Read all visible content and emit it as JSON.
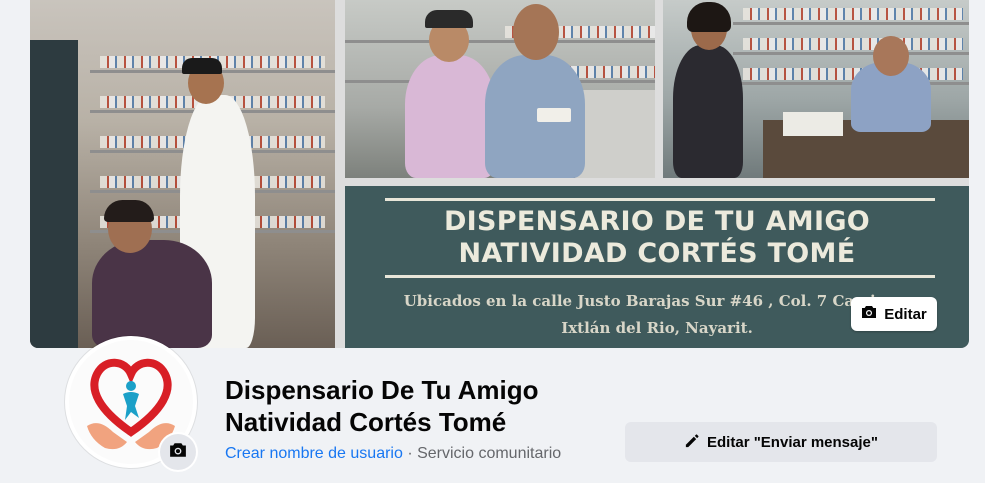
{
  "cover": {
    "banner_line1": "DISPENSARIO DE TU AMIGO",
    "banner_line2": "NATIVIDAD CORTÉS TOMÉ",
    "banner_address1": "Ubicados en la calle Justo Barajas  Sur #46 , Col. 7 Caminos.",
    "banner_address2": "Ixtlán del Rio, Nayarit.",
    "edit_label": "Editar",
    "edit_icon": "camera-icon"
  },
  "profile": {
    "name_line1": "Dispensario De Tu Amigo",
    "name_line2": "Natividad Cortés Tomé",
    "username_link": "Crear nombre de usuario",
    "separator": " · ",
    "category": "Servicio comunitario",
    "avatar_icon": "camera-icon"
  },
  "actions": {
    "send_message_label": "Editar \"Enviar mensaje\"",
    "send_message_icon": "pencil-icon"
  },
  "colors": {
    "link": "#1877f2",
    "banner": "#3f5a5c",
    "button_bg": "#e4e6eb"
  }
}
